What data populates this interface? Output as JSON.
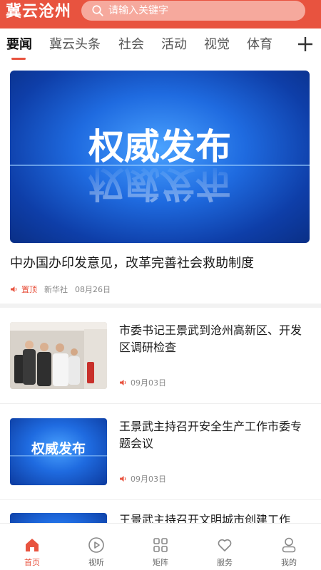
{
  "header": {
    "logo": "冀云沧州",
    "search_placeholder": "请输入关键字",
    "search_icon": "search-icon"
  },
  "tabs": {
    "items": [
      {
        "label": "要闻",
        "active": true
      },
      {
        "label": "冀云头条",
        "active": false
      },
      {
        "label": "社会",
        "active": false
      },
      {
        "label": "活动",
        "active": false
      },
      {
        "label": "视觉",
        "active": false
      },
      {
        "label": "体育",
        "active": false
      }
    ],
    "add_icon": "plus-icon",
    "accent": "#e8533f"
  },
  "hero": {
    "image_text": "权威发布",
    "title": "中办国办印发意见，改革完善社会救助制度",
    "pin_label": "置顶",
    "source": "新华社",
    "date": "08月26日"
  },
  "articles": [
    {
      "title": "市委书记王景武到沧州高新区、开发区调研检查",
      "date": "09月03日",
      "thumb": "photo"
    },
    {
      "title": "王景武主持召开安全生产工作市委专题会议",
      "date": "09月03日",
      "thumb_text": "权威发布"
    },
    {
      "title": "王景武主持召开文明城市创建工作"
    }
  ],
  "nav": {
    "items": [
      {
        "label": "首页",
        "icon": "home-icon",
        "active": true
      },
      {
        "label": "视听",
        "icon": "play-icon",
        "active": false
      },
      {
        "label": "矩阵",
        "icon": "grid-icon",
        "active": false
      },
      {
        "label": "服务",
        "icon": "heart-icon",
        "active": false
      },
      {
        "label": "我的",
        "icon": "user-icon",
        "active": false
      }
    ]
  }
}
